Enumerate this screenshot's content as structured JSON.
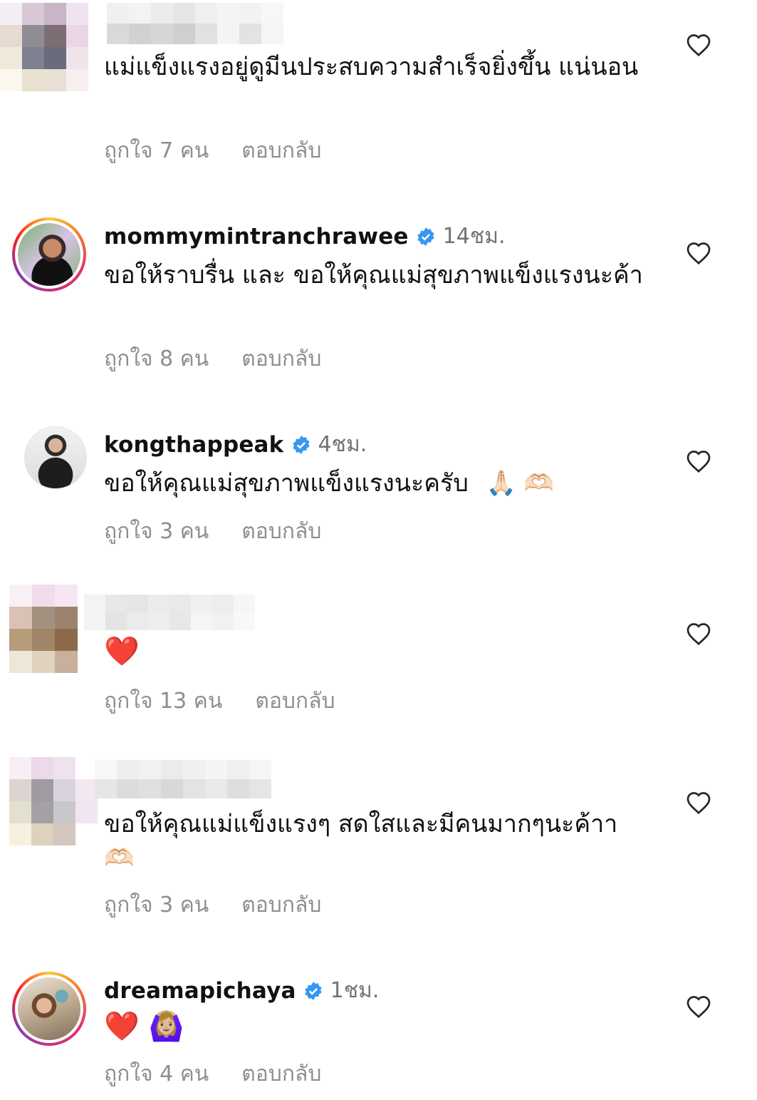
{
  "comments": [
    {
      "username": "",
      "time": "",
      "text": "แม่แข็งแรงอยู่ดูมีนประสบความสำเร็จยิ่งขึ้น แน่นอน",
      "likes": "ถูกใจ 7 คน",
      "reply": "ตอบกลับ"
    },
    {
      "username": "mommymintranchrawee",
      "time": "14ชม.",
      "text": "ขอให้ราบรื่น และ ขอให้คุณแม่สุขภาพแข็งแรงนะค้า",
      "likes": "ถูกใจ 8 คน",
      "reply": "ตอบกลับ"
    },
    {
      "username": "kongthappeak",
      "time": "4ชม.",
      "text": "ขอให้คุณแม่สุขภาพแข็งแรงนะครับ",
      "emoji": "🙏🏻 🫶🏻",
      "likes": "ถูกใจ 3 คน",
      "reply": "ตอบกลับ"
    },
    {
      "username": "",
      "time": "",
      "text": "❤️",
      "likes": "ถูกใจ 13 คน",
      "reply": "ตอบกลับ"
    },
    {
      "username": "",
      "time": "",
      "text": "ขอให้คุณแม่แข็งแรงๆ สดใสและมีคนมากๆนะค้าา",
      "emoji": "🫶🏻",
      "likes": "ถูกใจ 3 คน",
      "reply": "ตอบกลับ"
    },
    {
      "username": "dreamapichaya",
      "time": "1ชม.",
      "text": "❤️ 🙆🏼‍♀️",
      "likes": "ถูกใจ 4 คน",
      "reply": "ตอบกลับ"
    }
  ],
  "icons": {
    "like": "heart-outline-icon",
    "verified": "verified-badge-icon"
  },
  "colors": {
    "secondary_text": "#8e8e8e",
    "time_text": "#737373",
    "verified_blue": "#3897f0"
  }
}
